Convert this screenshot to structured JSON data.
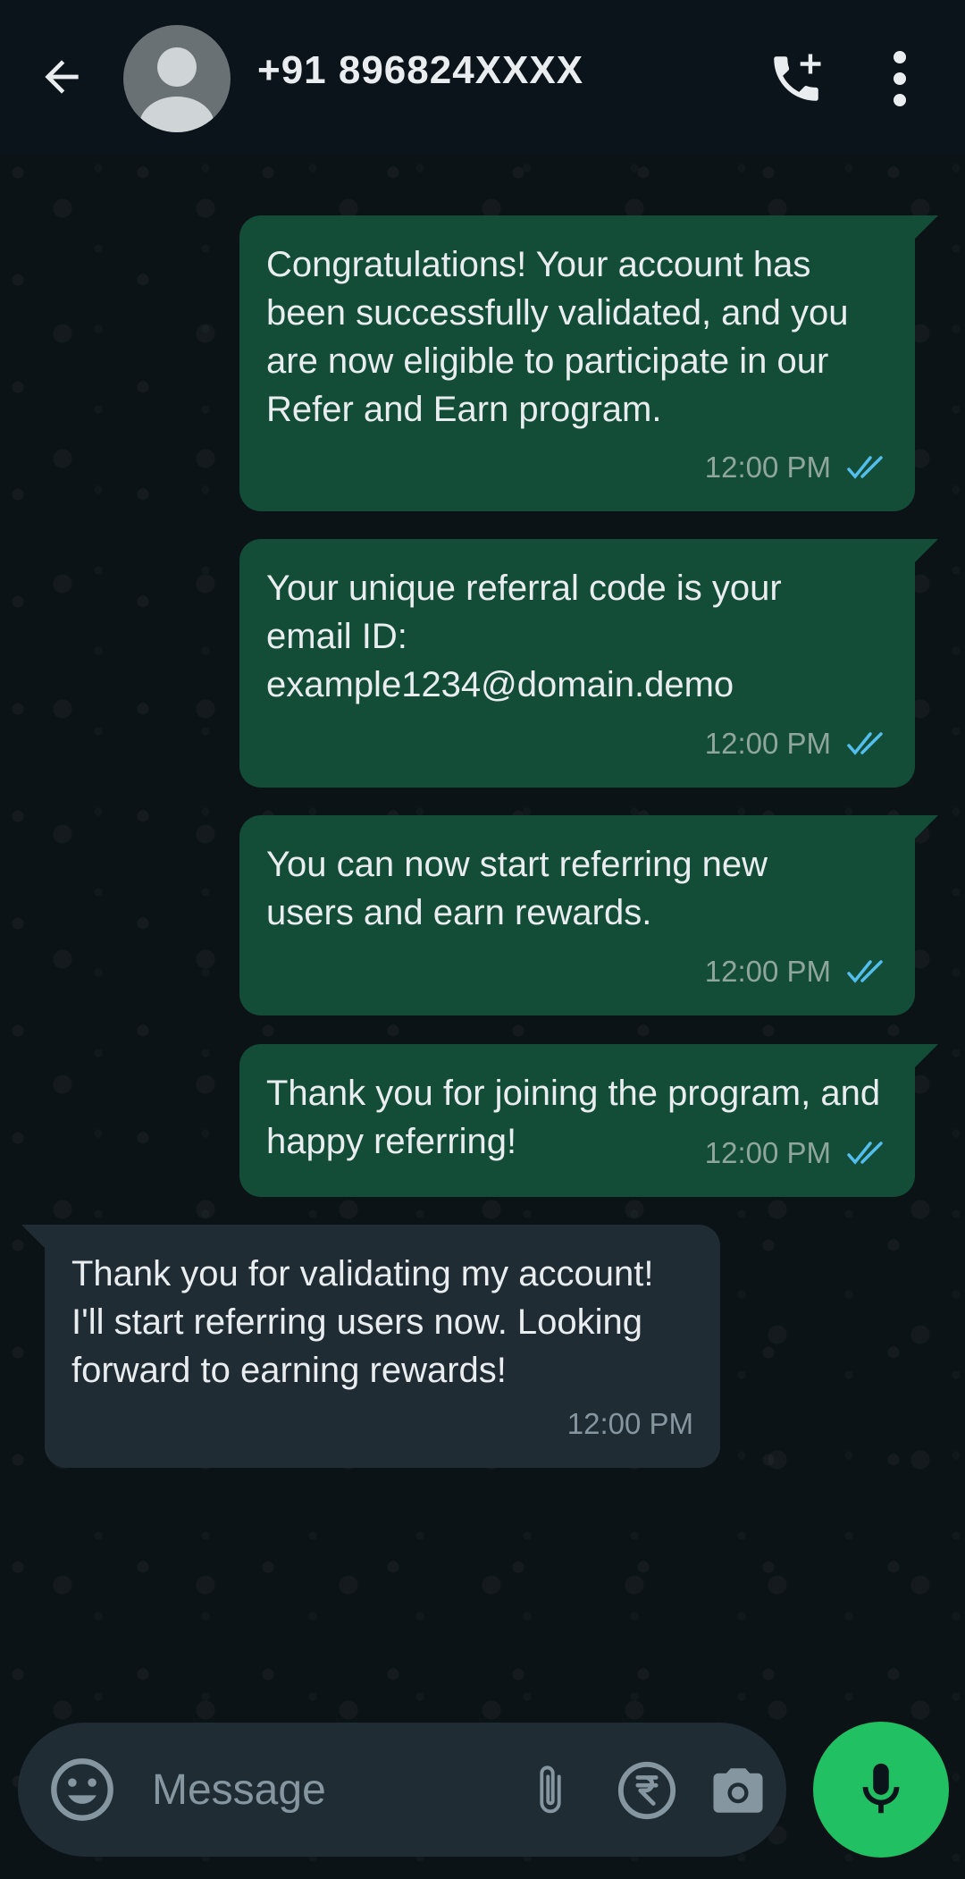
{
  "header": {
    "contact_name": "+91 896824XXXX",
    "icons": {
      "back": "arrow-left-icon",
      "avatar": "default-avatar-icon",
      "call": "add-call-icon",
      "menu": "more-vertical-icon"
    }
  },
  "messages": [
    {
      "direction": "outgoing",
      "text": "Congratulations! Your account has been successfully validated, and you are now eligible to participate in our Refer and Earn program.",
      "time": "12:00 PM",
      "status": "read"
    },
    {
      "direction": "outgoing",
      "text": "Your unique referral code is your email ID: example1234@domain.demo",
      "time": "12:00 PM",
      "status": "read"
    },
    {
      "direction": "outgoing",
      "text": "You can now start referring new users and earn rewards.",
      "time": "12:00 PM",
      "status": "read"
    },
    {
      "direction": "outgoing",
      "text": "Thank you for joining the program, and happy referring!",
      "time": "12:00 PM",
      "status": "read"
    },
    {
      "direction": "incoming",
      "text": "Thank you for validating my account! I'll start referring users now. Looking forward to earning rewards!",
      "time": "12:00 PM"
    }
  ],
  "composer": {
    "placeholder": "Message",
    "value": "",
    "icons": {
      "emoji": "emoji-icon",
      "attach": "paperclip-icon",
      "payment": "rupee-icon",
      "camera": "camera-icon",
      "mic": "microphone-icon"
    }
  },
  "colors": {
    "outgoing_bubble": "#134d37",
    "incoming_bubble": "#202c33",
    "read_ticks": "#53bdeb",
    "mic_button": "#21c063",
    "background": "#0b141a"
  }
}
